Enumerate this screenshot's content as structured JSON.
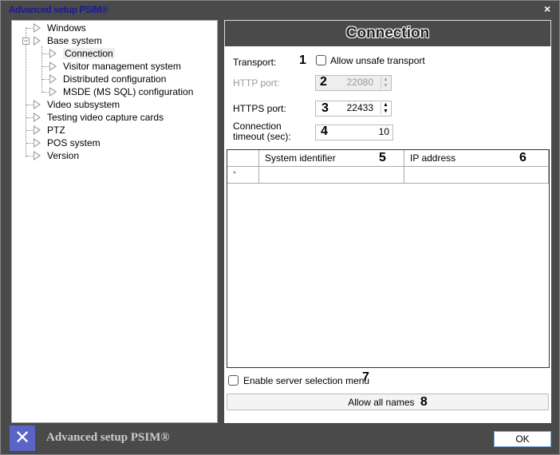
{
  "window": {
    "title": "Advanced setup PSIM®",
    "close": "×"
  },
  "tree": {
    "items": [
      {
        "label": "Windows"
      },
      {
        "label": "Base system"
      },
      {
        "label": "Connection"
      },
      {
        "label": "Visitor management system"
      },
      {
        "label": "Distributed configuration"
      },
      {
        "label": "MSDE (MS SQL) configuration"
      },
      {
        "label": "Video subsystem"
      },
      {
        "label": "Testing video capture cards"
      },
      {
        "label": "PTZ"
      },
      {
        "label": "POS system"
      },
      {
        "label": "Version"
      }
    ],
    "selected": "Connection",
    "collapse_glyph": "−"
  },
  "panel": {
    "title": "Connection",
    "transport_label": "Transport:",
    "allow_unsafe_label": "Allow unsafe transport",
    "allow_unsafe_checked": false,
    "http_label": "HTTP port:",
    "http_value": "22080",
    "https_label": "HTTPS port:",
    "https_value": "22433",
    "timeout_label": "Connection timeout (sec):",
    "timeout_value": "10",
    "grid": {
      "columns": [
        "",
        "System identifier",
        "IP address"
      ],
      "new_row_marker": "*"
    },
    "enable_server_menu_label": "Enable server selection menu",
    "enable_server_menu_checked": false,
    "allow_all_names_label": "Allow all names",
    "callouts": [
      "1",
      "2",
      "3",
      "4",
      "5",
      "6",
      "7",
      "8"
    ],
    "spin_up": "▲",
    "spin_down": "▼"
  },
  "footer": {
    "title": "Advanced setup PSIM®",
    "ok_label": "OK",
    "icon": "tools-icon"
  }
}
